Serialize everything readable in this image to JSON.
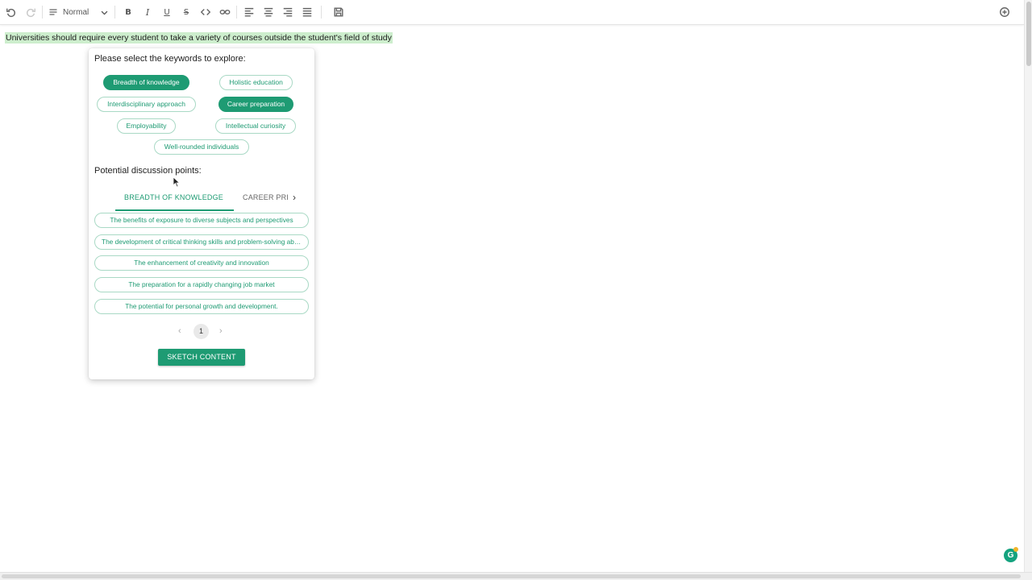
{
  "toolbar": {
    "style_label": "Normal",
    "icons": [
      "undo-icon",
      "redo-icon",
      "paragraph-style-icon",
      "bold-icon",
      "italic-icon",
      "underline-icon",
      "strikethrough-icon",
      "code-icon",
      "link-icon",
      "align-left-icon",
      "align-center-icon",
      "align-right-icon",
      "justify-icon",
      "save-icon",
      "add-circle-icon"
    ]
  },
  "document": {
    "text": "Universities should require every student to take a variety of courses outside the student's field of study"
  },
  "panel": {
    "keywords_title": "Please select the keywords to explore:",
    "keywords": [
      {
        "label": "Breadth of knowledge",
        "selected": true
      },
      {
        "label": "Holistic education",
        "selected": false
      },
      {
        "label": "Interdisciplinary approach",
        "selected": false
      },
      {
        "label": "Career preparation",
        "selected": true
      },
      {
        "label": "Employability",
        "selected": false
      },
      {
        "label": "Intellectual curiosity",
        "selected": false
      },
      {
        "label": "Well-rounded individuals",
        "selected": false
      }
    ],
    "points_title": "Potential discussion points:",
    "tabs": [
      {
        "label": "BREADTH OF KNOWLEDGE",
        "active": true
      },
      {
        "label": "CAREER PRI",
        "active": false
      }
    ],
    "points": [
      "The benefits of exposure to diverse subjects and perspectives",
      "The development of critical thinking skills and problem-solving abilities",
      "The enhancement of creativity and innovation",
      "The preparation for a rapidly changing job market",
      "The potential for personal growth and development."
    ],
    "pagination": {
      "prev": "‹",
      "page": "1",
      "next": "›"
    },
    "sketch_button": "SKETCH CONTENT"
  },
  "badge": {
    "letter": "G"
  },
  "colors": {
    "accent": "#1e9b73",
    "highlight": "#cdeecd"
  }
}
